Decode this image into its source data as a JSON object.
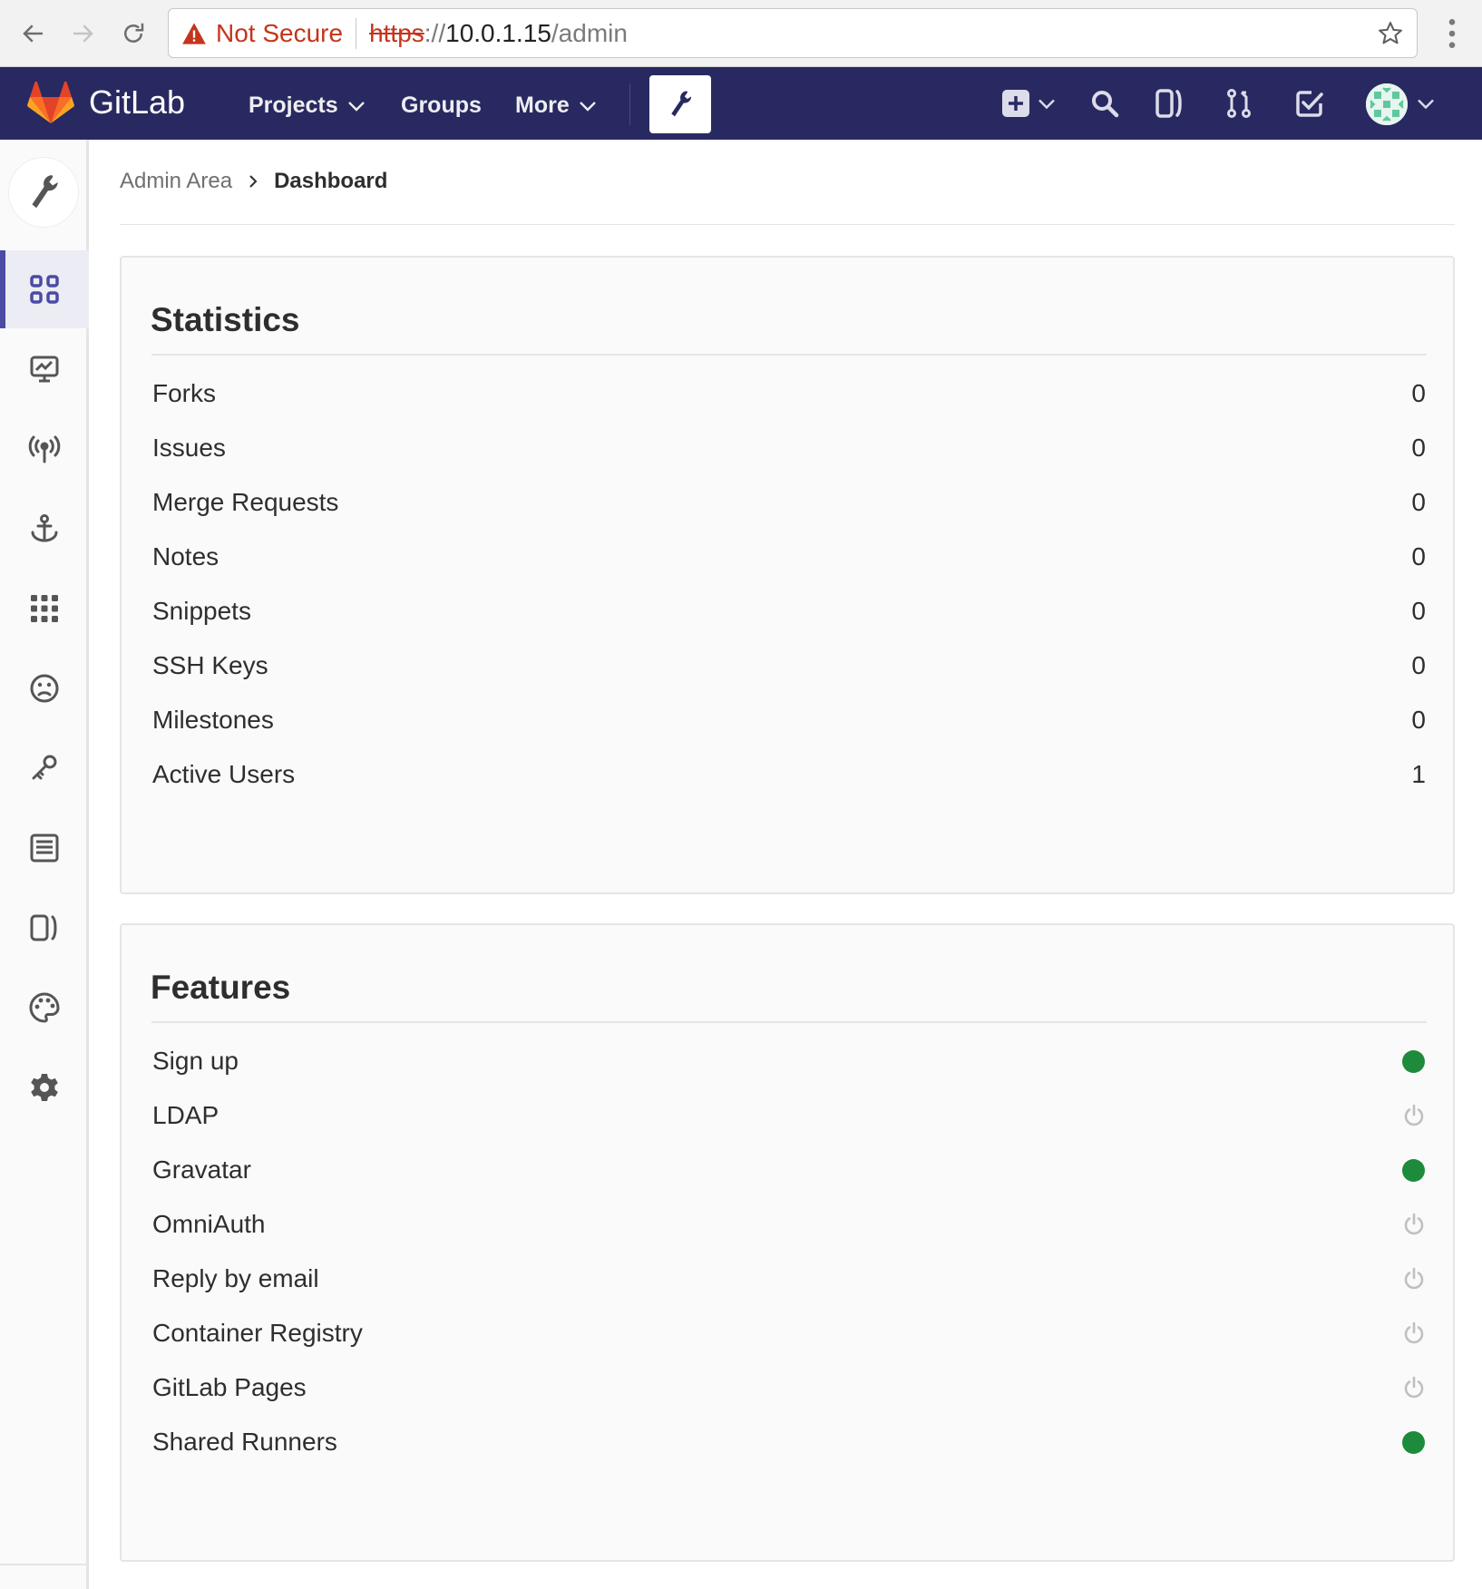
{
  "browser": {
    "not_secure": "Not Secure",
    "url_scheme": "https",
    "url_colon": "://",
    "url_host": "10.0.1.15",
    "url_path": "/admin"
  },
  "header": {
    "brand": "GitLab",
    "nav": [
      "Projects",
      "Groups",
      "More"
    ]
  },
  "breadcrumb": [
    "Admin Area",
    "Dashboard"
  ],
  "statistics": {
    "title": "Statistics",
    "rows": [
      {
        "label": "Forks",
        "value": "0"
      },
      {
        "label": "Issues",
        "value": "0"
      },
      {
        "label": "Merge Requests",
        "value": "0"
      },
      {
        "label": "Notes",
        "value": "0"
      },
      {
        "label": "Snippets",
        "value": "0"
      },
      {
        "label": "SSH Keys",
        "value": "0"
      },
      {
        "label": "Milestones",
        "value": "0"
      },
      {
        "label": "Active Users",
        "value": "1"
      }
    ]
  },
  "features": {
    "title": "Features",
    "rows": [
      {
        "label": "Sign up",
        "status": "on"
      },
      {
        "label": "LDAP",
        "status": "off"
      },
      {
        "label": "Gravatar",
        "status": "on"
      },
      {
        "label": "OmniAuth",
        "status": "off"
      },
      {
        "label": "Reply by email",
        "status": "off"
      },
      {
        "label": "Container Registry",
        "status": "off"
      },
      {
        "label": "GitLab Pages",
        "status": "off"
      },
      {
        "label": "Shared Runners",
        "status": "on"
      }
    ]
  },
  "colors": {
    "header_bg": "#292961",
    "status_on": "#1e8a3c",
    "status_off": "#c0c0c0",
    "active_accent": "#4b4ba3"
  },
  "sidebar_icons": [
    "overview-icon",
    "monitoring-icon",
    "messages-icon",
    "hooks-icon",
    "applications-icon",
    "abuse-reports-icon",
    "deploy-keys-icon",
    "service-templates-icon",
    "labels-icon",
    "appearance-icon",
    "settings-icon"
  ]
}
